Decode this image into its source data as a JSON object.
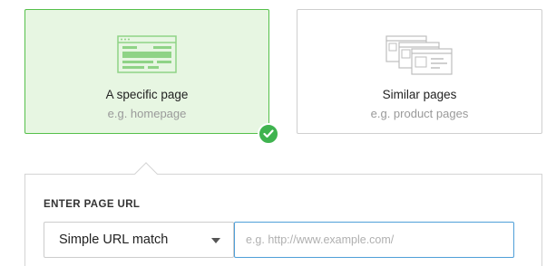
{
  "cards": [
    {
      "title": "A specific page",
      "subtitle": "e.g. homepage",
      "selected": true,
      "icon": "single-page-icon"
    },
    {
      "title": "Similar pages",
      "subtitle": "e.g. product pages",
      "selected": false,
      "icon": "multiple-pages-icon"
    }
  ],
  "selected_badge_icon": "checkmark-icon",
  "url_section": {
    "label": "ENTER PAGE URL",
    "match_type": "Simple URL match",
    "url_placeholder": "e.g. http://www.example.com/",
    "url_value": ""
  },
  "colors": {
    "selected_bg": "#e7f6e2",
    "selected_border": "#55c04a",
    "check_green": "#3fb34f",
    "input_focus_border": "#4f9fd8"
  }
}
